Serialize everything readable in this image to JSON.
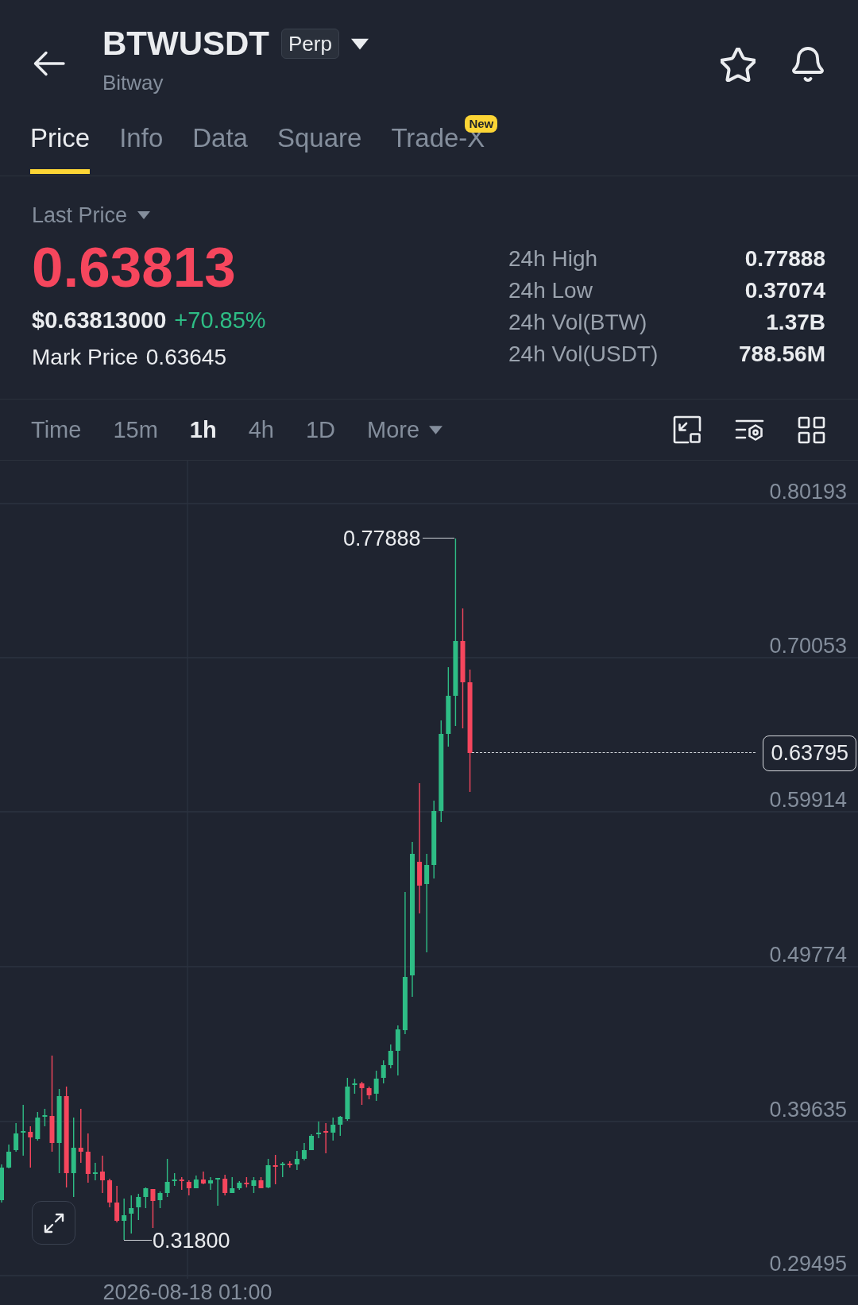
{
  "header": {
    "symbol": "BTWUSDT",
    "contract_type": "Perp",
    "name": "Bitway"
  },
  "tabs": [
    {
      "label": "Price",
      "selected": true
    },
    {
      "label": "Info",
      "selected": false
    },
    {
      "label": "Data",
      "selected": false
    },
    {
      "label": "Square",
      "selected": false
    },
    {
      "label": "Trade-X",
      "selected": false,
      "badge": "New"
    }
  ],
  "price": {
    "label": "Last Price",
    "last": "0.63813",
    "last_falling": true,
    "usd": "$0.63813000",
    "change": "+70.85%",
    "change_rising": true,
    "mark_label": "Mark Price",
    "mark": "0.63645"
  },
  "stats": [
    {
      "label": "24h High",
      "value": "0.77888"
    },
    {
      "label": "24h Low",
      "value": "0.37074"
    },
    {
      "label": "24h Vol(BTW)",
      "value": "1.37B"
    },
    {
      "label": "24h Vol(USDT)",
      "value": "788.56M"
    }
  ],
  "intervals": [
    {
      "label": "Time",
      "kind": "interval",
      "selected": false
    },
    {
      "label": "15m",
      "kind": "interval",
      "selected": false
    },
    {
      "label": "1h",
      "kind": "interval",
      "selected": true
    },
    {
      "label": "4h",
      "kind": "interval",
      "selected": false
    },
    {
      "label": "1D",
      "kind": "interval",
      "selected": false
    },
    {
      "label": "More",
      "kind": "menu",
      "selected": false
    }
  ],
  "chart": {
    "price_axis": [
      "0.80193",
      "0.70053",
      "0.59914",
      "0.49774",
      "0.39635",
      "0.29495"
    ],
    "high_label": "0.77888",
    "low_label": "0.31800",
    "last_price": "0.63795",
    "time_label": "2026-08-18 01:00"
  }
}
